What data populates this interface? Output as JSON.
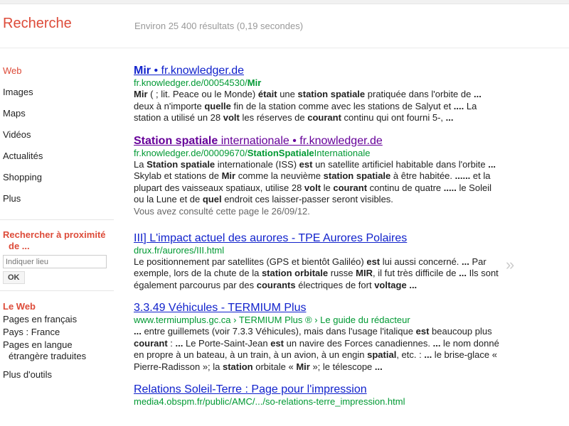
{
  "header": {
    "logo": "Recherche",
    "stats": "Environ 25 400 résultats (0,19 secondes)"
  },
  "nav": {
    "items": [
      "Web",
      "Images",
      "Maps",
      "Vidéos",
      "Actualités",
      "Shopping",
      "Plus"
    ]
  },
  "proximity": {
    "title1": "Rechercher à proximité",
    "title2": "de ...",
    "placeholder": "Indiquer lieu",
    "ok": "OK"
  },
  "tools": {
    "title": "Le Web",
    "items": [
      "Pages en français",
      "Pays : France"
    ],
    "translated1": "Pages en langue",
    "translated2": "étrangère traduites",
    "more": "Plus d'outils"
  },
  "results": [
    {
      "title": [
        [
          "Mir",
          1
        ],
        [
          " • fr.knowledger.de",
          0
        ]
      ],
      "visited": false,
      "url": [
        [
          "fr.knowledger.de/00054530/",
          0
        ],
        [
          "Mir",
          1
        ]
      ],
      "snippet": [
        [
          "Mir",
          1
        ],
        [
          " ( ; lit. Peace ou le Monde) ",
          0
        ],
        [
          "était",
          1
        ],
        [
          " une ",
          0
        ],
        [
          "station spatiale",
          1
        ],
        [
          " pratiquée dans l'orbite de ",
          0
        ],
        [
          "...",
          1
        ],
        [
          " deux à n'importe ",
          0
        ],
        [
          "quelle",
          1
        ],
        [
          " fin de la station comme avec les stations de Salyut et ",
          0
        ],
        [
          "....",
          1
        ],
        [
          " La station a utilisé un 28 ",
          0
        ],
        [
          "volt",
          1
        ],
        [
          " les réserves de ",
          0
        ],
        [
          "courant",
          1
        ],
        [
          " continu qui ont fourni 5-, ",
          0
        ],
        [
          "...",
          1
        ]
      ]
    },
    {
      "title": [
        [
          "Station spatiale",
          1
        ],
        [
          " internationale • fr.knowledger.de",
          0
        ]
      ],
      "visited": true,
      "url": [
        [
          "fr.knowledger.de/00009670/",
          0
        ],
        [
          "StationSpatiale",
          1
        ],
        [
          "Internationale",
          0
        ]
      ],
      "snippet": [
        [
          "La ",
          0
        ],
        [
          "Station spatiale",
          1
        ],
        [
          " internationale (ISS) ",
          0
        ],
        [
          "est",
          1
        ],
        [
          " un satellite artificiel habitable dans l'orbite ",
          0
        ],
        [
          "...",
          1
        ],
        [
          " Skylab et stations de ",
          0
        ],
        [
          "Mir",
          1
        ],
        [
          " comme la neuvième ",
          0
        ],
        [
          "station spatiale",
          1
        ],
        [
          " à être habitée. ",
          0
        ],
        [
          "......",
          1
        ],
        [
          " et la plupart des vaisseaux spatiaux, utilise 28 ",
          0
        ],
        [
          "volt",
          1
        ],
        [
          " le ",
          0
        ],
        [
          "courant",
          1
        ],
        [
          " continu de quatre ",
          0
        ],
        [
          ".....",
          1
        ],
        [
          " le Soleil ou la Lune et de ",
          0
        ],
        [
          "quel",
          1
        ],
        [
          " endroit ces laisser-passer seront visibles.",
          0
        ]
      ],
      "visited_note": "Vous avez consulté cette page le 26/09/12."
    },
    {
      "title": [
        [
          "III] L'impact actuel des aurores - TPE Aurores Polaires",
          0
        ]
      ],
      "visited": false,
      "url": [
        [
          "drux.fr/aurores/III.html",
          0
        ]
      ],
      "snippet": [
        [
          "Le positionnement par satellites (GPS et bientôt Galiléo) ",
          0
        ],
        [
          "est",
          1
        ],
        [
          " lui aussi concerné. ",
          0
        ],
        [
          "...",
          1
        ],
        [
          " Par exemple, lors de la chute de la ",
          0
        ],
        [
          "station orbitale",
          1
        ],
        [
          " russe ",
          0
        ],
        [
          "MIR",
          1
        ],
        [
          ", il fut très difficile de ",
          0
        ],
        [
          "...",
          1
        ],
        [
          " Ils sont également parcourus par des ",
          0
        ],
        [
          "courants",
          1
        ],
        [
          " électriques de fort ",
          0
        ],
        [
          "voltage",
          1
        ],
        [
          " ",
          0
        ],
        [
          "...",
          1
        ]
      ]
    },
    {
      "title": [
        [
          "3.3.49 Véhicules - TERMIUM Plus",
          0
        ]
      ],
      "visited": false,
      "url": [
        [
          "www.termiumplus.gc.ca › TERMIUM Plus ® › Le guide du rédacteur",
          0
        ]
      ],
      "snippet": [
        [
          "...",
          1
        ],
        [
          " entre guillemets (voir 7.3.3 Véhicules), mais dans l'usage l'italique ",
          0
        ],
        [
          "est",
          1
        ],
        [
          " beaucoup plus ",
          0
        ],
        [
          "courant",
          1
        ],
        [
          " : ",
          0
        ],
        [
          "...",
          1
        ],
        [
          " Le Porte-Saint-Jean ",
          0
        ],
        [
          "est",
          1
        ],
        [
          " un navire des Forces canadiennes. ",
          0
        ],
        [
          "...",
          1
        ],
        [
          " le nom donné en propre à un bateau, à un train, à un avion, à un engin ",
          0
        ],
        [
          "spatial",
          1
        ],
        [
          ", etc. : ",
          0
        ],
        [
          "...",
          1
        ],
        [
          " le brise-glace « Pierre-Radisson »; la ",
          0
        ],
        [
          "station",
          1
        ],
        [
          " orbitale « ",
          0
        ],
        [
          "Mir",
          1
        ],
        [
          " »; le télescope ",
          0
        ],
        [
          "...",
          1
        ]
      ]
    },
    {
      "title": [
        [
          "Relations Soleil-Terre : Page pour l'impression",
          0
        ]
      ],
      "visited": false,
      "url": [
        [
          "media4.obspm.fr/public/AMC/.../so-relations-terre_impression.html",
          0
        ]
      ],
      "snippet": []
    }
  ],
  "preview_arrow": "»",
  "colors": {
    "accent": "#dd4b39",
    "link": "#1122cc",
    "visited": "#660099",
    "url": "#009933"
  }
}
